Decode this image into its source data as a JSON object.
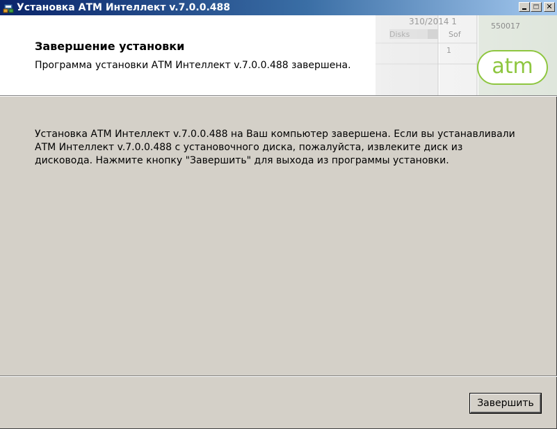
{
  "window": {
    "title": "Установка АТМ Интеллект v.7.0.0.488",
    "minimize_symbol": "_",
    "maximize_symbol": "□",
    "close_symbol": "✕"
  },
  "header": {
    "title": "Завершение установки",
    "subtitle": "Программа установки АТМ Интеллект v.7.0.0.488 завершена.",
    "logo_text": "atm",
    "background_snippets": [
      "310/2014 1",
      "550017",
      "Disks",
      "Sof",
      "1"
    ]
  },
  "main": {
    "message": "Установка АТМ Интеллект v.7.0.0.488 на Ваш компьютер завершена. Если вы устанавливали АТМ Интеллект v.7.0.0.488 с установочного диска, пожалуйста, извлеките диск из дисковода. Нажмите кнопку \"Завершить\" для выхода из программы установки."
  },
  "footer": {
    "finish_label": "Завершить"
  },
  "colors": {
    "titlebar_start": "#0a246a",
    "titlebar_end": "#a6caf0",
    "dialog_bg": "#d4d0c8",
    "logo_green": "#8ec63f"
  }
}
